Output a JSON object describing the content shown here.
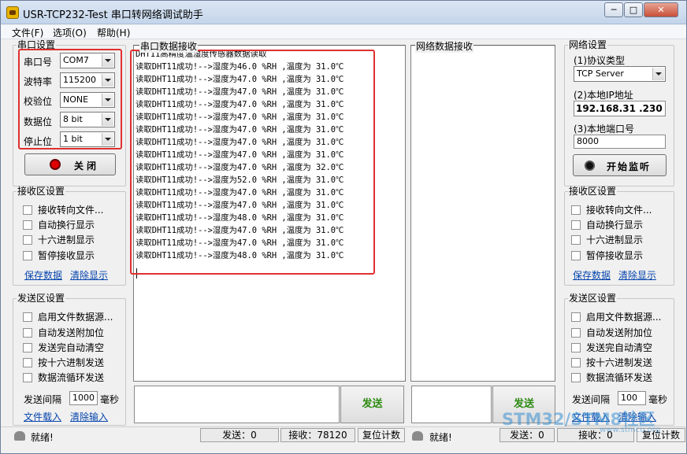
{
  "window": {
    "title": "USR-TCP232-Test 串口转网络调试助手",
    "minimize": "─",
    "maximize": "□",
    "close": "✕"
  },
  "menu": [
    {
      "label": "文件(F)"
    },
    {
      "label": "选项(O)"
    },
    {
      "label": "帮助(H)"
    }
  ],
  "serial_settings": {
    "legend": "串口设置",
    "port": {
      "label": "串口号",
      "value": "COM7"
    },
    "baud": {
      "label": "波特率",
      "value": "115200"
    },
    "parity": {
      "label": "校验位",
      "value": "NONE"
    },
    "databits": {
      "label": "数据位",
      "value": "8 bit"
    },
    "stopbits": {
      "label": "停止位",
      "value": "1 bit"
    },
    "close_button": "关闭"
  },
  "left_receive": {
    "legend": "接收区设置",
    "options": [
      "接收转向文件...",
      "自动换行显示",
      "十六进制显示",
      "暂停接收显示"
    ],
    "save_link": "保存数据",
    "clear_link": "清除显示"
  },
  "left_send": {
    "legend": "发送区设置",
    "options": [
      "启用文件数据源...",
      "自动发送附加位",
      "发送完自动清空",
      "按十六进制发送",
      "数据流循环发送"
    ],
    "interval_label": "发送间隔",
    "interval_value": "1000",
    "interval_unit": "毫秒",
    "load_link": "文件载入",
    "clear_link": "清除输入"
  },
  "serial_receive": {
    "legend": "串口数据接收",
    "lines": [
      "DHT11高精度温湿度传感器数据读取",
      "读取DHT11成功!-->湿度为46.0 %RH ,温度为 31.0℃",
      "读取DHT11成功!-->湿度为47.0 %RH ,温度为 31.0℃",
      "读取DHT11成功!-->湿度为47.0 %RH ,温度为 31.0℃",
      "读取DHT11成功!-->湿度为47.0 %RH ,温度为 31.0℃",
      "读取DHT11成功!-->湿度为47.0 %RH ,温度为 31.0℃",
      "读取DHT11成功!-->湿度为47.0 %RH ,温度为 31.0℃",
      "读取DHT11成功!-->湿度为47.0 %RH ,温度为 31.0℃",
      "读取DHT11成功!-->湿度为47.0 %RH ,温度为 31.0℃",
      "读取DHT11成功!-->湿度为47.0 %RH ,温度为 32.0℃",
      "读取DHT11成功!-->湿度为52.0 %RH ,温度为 31.0℃",
      "读取DHT11成功!-->湿度为47.0 %RH ,温度为 31.0℃",
      "读取DHT11成功!-->湿度为47.0 %RH ,温度为 31.0℃",
      "读取DHT11成功!-->湿度为48.0 %RH ,温度为 31.0℃",
      "读取DHT11成功!-->湿度为47.0 %RH ,温度为 31.0℃",
      "读取DHT11成功!-->湿度为47.0 %RH ,温度为 31.0℃",
      "读取DHT11成功!-->湿度为48.0 %RH ,温度为 31.0℃"
    ]
  },
  "net_receive": {
    "legend": "网络数据接收"
  },
  "network_settings": {
    "legend": "网络设置",
    "protocol_label": "(1)协议类型",
    "protocol_value": "TCP Server",
    "ip_label": "(2)本地IP地址",
    "ip_value": "192.168.31 .230",
    "port_label": "(3)本地端口号",
    "port_value": "8000",
    "listen_button": "开始监听"
  },
  "right_receive": {
    "legend": "接收区设置",
    "options": [
      "接收转向文件...",
      "自动换行显示",
      "十六进制显示",
      "暂停接收显示"
    ],
    "save_link": "保存数据",
    "clear_link": "清除显示"
  },
  "right_send": {
    "legend": "发送区设置",
    "options": [
      "启用文件数据源...",
      "自动发送附加位",
      "发送完自动清空",
      "按十六进制发送",
      "数据流循环发送"
    ],
    "interval_label": "发送间隔",
    "interval_value": "100",
    "interval_unit": "毫秒",
    "load_link": "文件载入",
    "clear_link": "清除输入"
  },
  "send_button": "发送",
  "status_left": {
    "ready": "就绪!",
    "send": "发送：0",
    "recv": "接收：78120",
    "reset": "复位计数"
  },
  "status_right": {
    "ready": "就绪!",
    "send": "发送：0",
    "recv": "接收：0",
    "reset": "复位计数"
  },
  "watermark": {
    "text": "STM32/STM8社区",
    "sub": "www.stmcu.org"
  },
  "colors": {
    "highlight": "#e03030",
    "send_text": "#2d8a12",
    "link": "#0645ad"
  }
}
